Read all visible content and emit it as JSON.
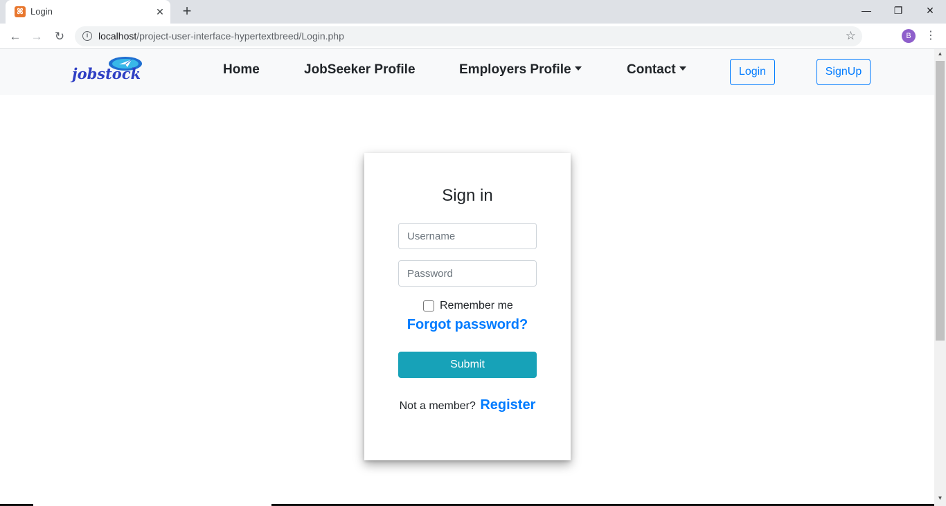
{
  "browser": {
    "tab_title": "Login",
    "favicon": "xampp-icon",
    "url_host": "localhost",
    "url_path": "/project-user-interface-hypertextbreed/Login.php",
    "profile_initial": "B"
  },
  "navbar": {
    "logo_text": "jobstock",
    "links": [
      {
        "label": "Home",
        "dropdown": false
      },
      {
        "label": "JobSeeker Profile",
        "dropdown": false
      },
      {
        "label": "Employers Profile",
        "dropdown": true
      },
      {
        "label": "Contact",
        "dropdown": true
      }
    ],
    "login_label": "Login",
    "signup_label": "SignUp"
  },
  "form": {
    "title": "Sign in",
    "username_placeholder": "Username",
    "password_placeholder": "Password",
    "remember_label": "Remember me",
    "forgot_label": "Forgot password?",
    "submit_label": "Submit",
    "member_text": "Not a member?",
    "register_label": "Register"
  },
  "colors": {
    "primary": "#007bff",
    "submit": "#17a2b8",
    "navbar_bg": "#f8f9fa"
  }
}
